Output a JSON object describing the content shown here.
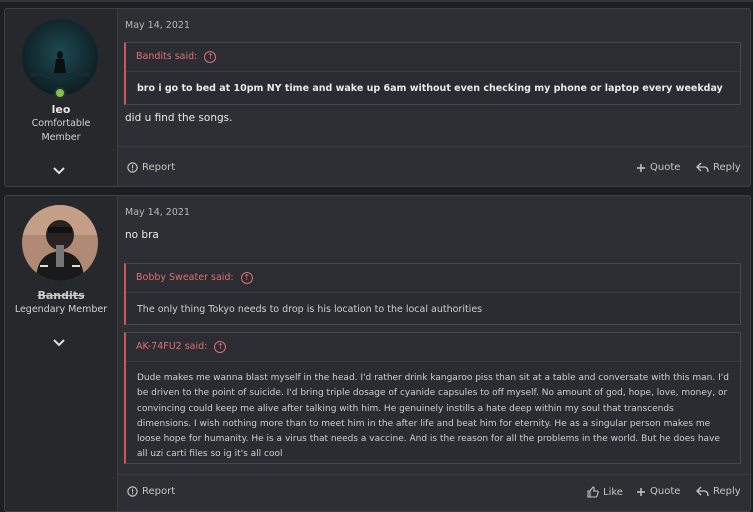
{
  "posts": [
    {
      "user": {
        "name": "leo",
        "title_line1": "Comfortable",
        "title_line2": "Member"
      },
      "date": "May 14, 2021",
      "quote": {
        "author": "Bandits said:",
        "text": "bro i go to bed at 10pm NY time and wake up 6am without even checking my phone or laptop every weekday"
      },
      "message": "did u find the songs.",
      "actions": {
        "report": "Report",
        "quote": "Quote",
        "reply": "Reply"
      }
    },
    {
      "user": {
        "name": "Bandits",
        "title": "Legendary Member"
      },
      "date": "May 14, 2021",
      "message": "no bra",
      "quotes": [
        {
          "author": "Bobby Sweater said:",
          "text": "The only thing Tokyo needs to drop is his location to the local authorities"
        },
        {
          "author": "AK-74FU2 said:",
          "text": "Dude makes me wanna blast myself in the head. I'd rather drink kangaroo piss than sit at a table and conversate with this man. I'd be driven to the point of suicide. I'd bring triple dosage of cyanide capsules to off myself. No amount of god, hope, love, money, or convincing could keep me alive after talking with him. He genuinely instills a hate deep within my soul that transcends dimensions. I wish nothing more than to meet him in the after life and beat him for eternity. He as a singular person makes me loose hope for humanity. He is a virus that needs a vaccine. And is the reason for all the problems in the world. But he does have all uzi carti files so ig it's all cool"
        }
      ],
      "actions": {
        "report": "Report",
        "like": "Like",
        "quote": "Quote",
        "reply": "Reply"
      }
    }
  ],
  "icons": [
    "online-indicator-icon",
    "chevron-down-icon",
    "report-icon",
    "plus-icon",
    "reply-icon",
    "thumbs-up-icon",
    "arrow-up-circle-icon"
  ],
  "colors": {
    "quote_accent": "#e07070",
    "online": "#7ec14b"
  }
}
